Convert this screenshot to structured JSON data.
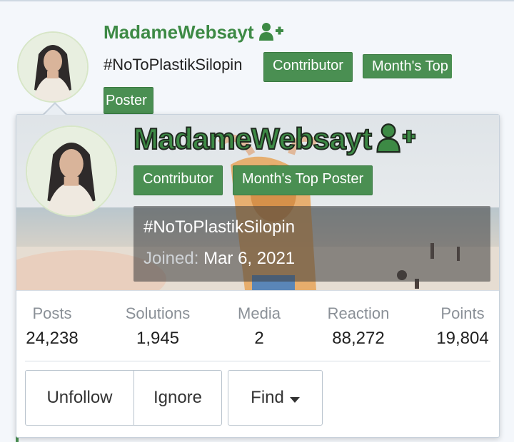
{
  "post": {
    "username": "MadameWebsayt",
    "signature": "#NoToPlastikSilopin",
    "badges": [
      "Contributor",
      "Month's Top",
      "Poster"
    ]
  },
  "card": {
    "username": "MadameWebsayt",
    "badges": [
      "Contributor",
      "Month's Top Poster"
    ],
    "signature": "#NoToPlastikSilopin",
    "joined_label": "Joined:",
    "joined_value": "Mar 6, 2021",
    "stats": [
      {
        "label": "Posts",
        "value": "24,238"
      },
      {
        "label": "Solutions",
        "value": "1,945"
      },
      {
        "label": "Media",
        "value": "2"
      },
      {
        "label": "Reaction",
        "value": "88,272"
      },
      {
        "label": "Points",
        "value": "19,804"
      }
    ],
    "buttons": {
      "unfollow": "Unfollow",
      "ignore": "Ignore",
      "find": "Find"
    }
  },
  "icons": {
    "follow": "user-plus-icon",
    "dropdown": "caret-down-icon"
  },
  "colors": {
    "accent": "#3d8a45",
    "badge": "#4a8f52",
    "muted_text": "#8a9097"
  }
}
